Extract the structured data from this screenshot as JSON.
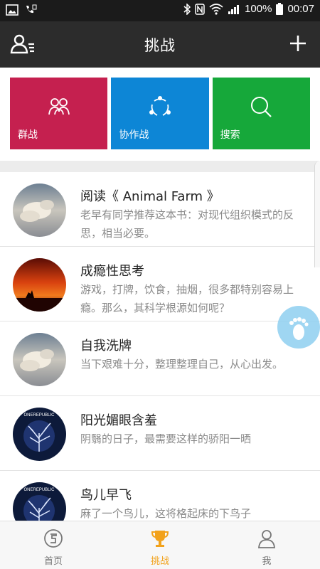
{
  "status_bar": {
    "battery": "100%",
    "time": "00:07",
    "icons": [
      "image-icon",
      "call-icon",
      "bluetooth-icon",
      "nfc-icon",
      "wifi-icon",
      "signal-icon",
      "battery-icon"
    ]
  },
  "header": {
    "title": "挑战",
    "left_icon": "contacts-icon",
    "right_icon": "plus-icon"
  },
  "tiles": [
    {
      "label": "群战",
      "icon": "group-icon",
      "color": "#c5204f"
    },
    {
      "label": "协作战",
      "icon": "share-icon",
      "color": "#0d86d6"
    },
    {
      "label": "搜索",
      "icon": "search-icon",
      "color": "#16a83a"
    }
  ],
  "items": [
    {
      "title": "阅读《 Animal Farm 》",
      "desc": "老早有同学推荐这本书：对现代组织模式的反思，相当必要。",
      "avatar": "clouds-photo"
    },
    {
      "title": "成瘾性思考",
      "desc": "游戏，打牌，饮食，抽烟，很多都特别容易上瘾。那么，其科学根源如何呢？",
      "avatar": "sunset-photo"
    },
    {
      "title": "自我洗牌",
      "desc": "当下艰难十分，整理整理自己，从心出发。",
      "avatar": "clouds-photo"
    },
    {
      "title": "阳光媚眼含羞",
      "desc": "阴翳的日子，最需要这样的骄阳一晒",
      "avatar": "onerepublic-album"
    },
    {
      "title": "鸟儿早飞",
      "desc": "麻了一个鸟儿，这将格起床的下鸟子",
      "avatar": "onerepublic-album"
    }
  ],
  "album_text": "ONEREPUBLIC",
  "float_icon": "footprint-icon",
  "nav": [
    {
      "label": "首页",
      "icon": "home-icon",
      "active": false
    },
    {
      "label": "挑战",
      "icon": "trophy-icon",
      "active": true
    },
    {
      "label": "我",
      "icon": "person-icon",
      "active": false
    }
  ],
  "colors": {
    "status_bar": "#1b1b1b",
    "header": "#2c2c2c",
    "accent": "#f2a21b",
    "float_button": "#8fd0f0"
  }
}
